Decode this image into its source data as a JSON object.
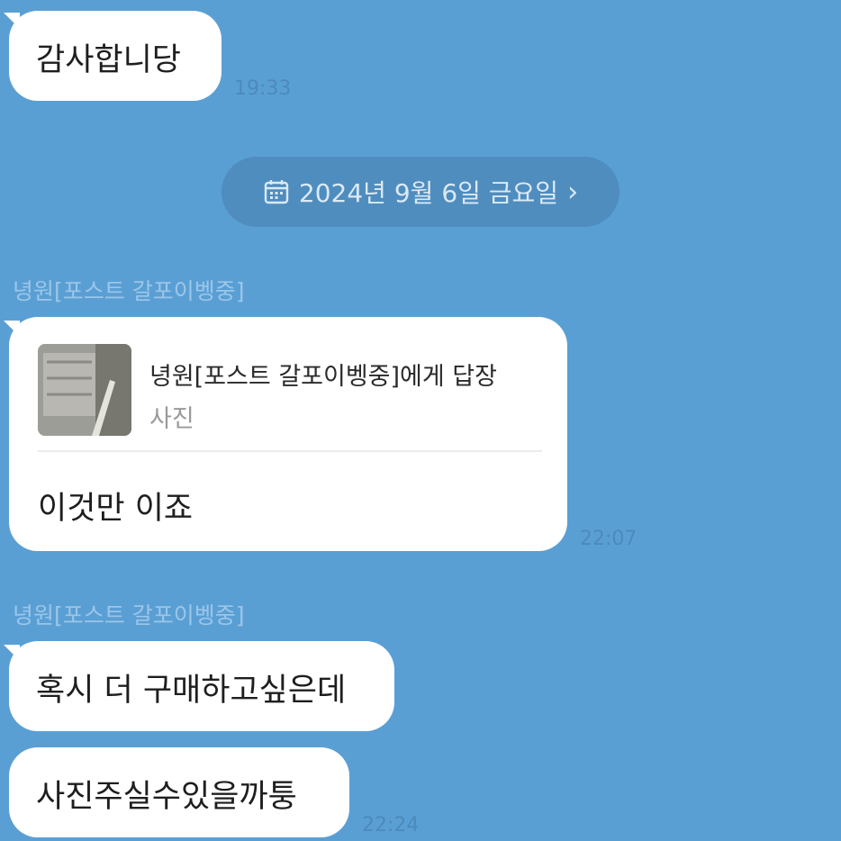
{
  "colors": {
    "background": "#5a9fd4",
    "bubble": "#ffffff",
    "date_pill": "#4f8dbe",
    "sender_name": "#9cc6e8",
    "timestamp": "#4b88b8"
  },
  "messages": {
    "m1": {
      "text": "감사합니당",
      "time": "19:33"
    },
    "date_separator": {
      "text": "2024년 9월 6일 금요일",
      "chevron": "›",
      "icon": "calendar-icon"
    },
    "m2": {
      "sender": "녕원[포스트 갈포이벵중]",
      "reply_title": "녕원[포스트 갈포이벵중]에게 답장",
      "reply_type": "사진",
      "text": "이것만 이죠",
      "time": "22:07"
    },
    "m3": {
      "sender": "녕원[포스트 갈포이벵중]",
      "text": "혹시 더 구매하고싶은데"
    },
    "m4": {
      "text": "사진주실수있을까퉁",
      "time": "22:24"
    }
  }
}
